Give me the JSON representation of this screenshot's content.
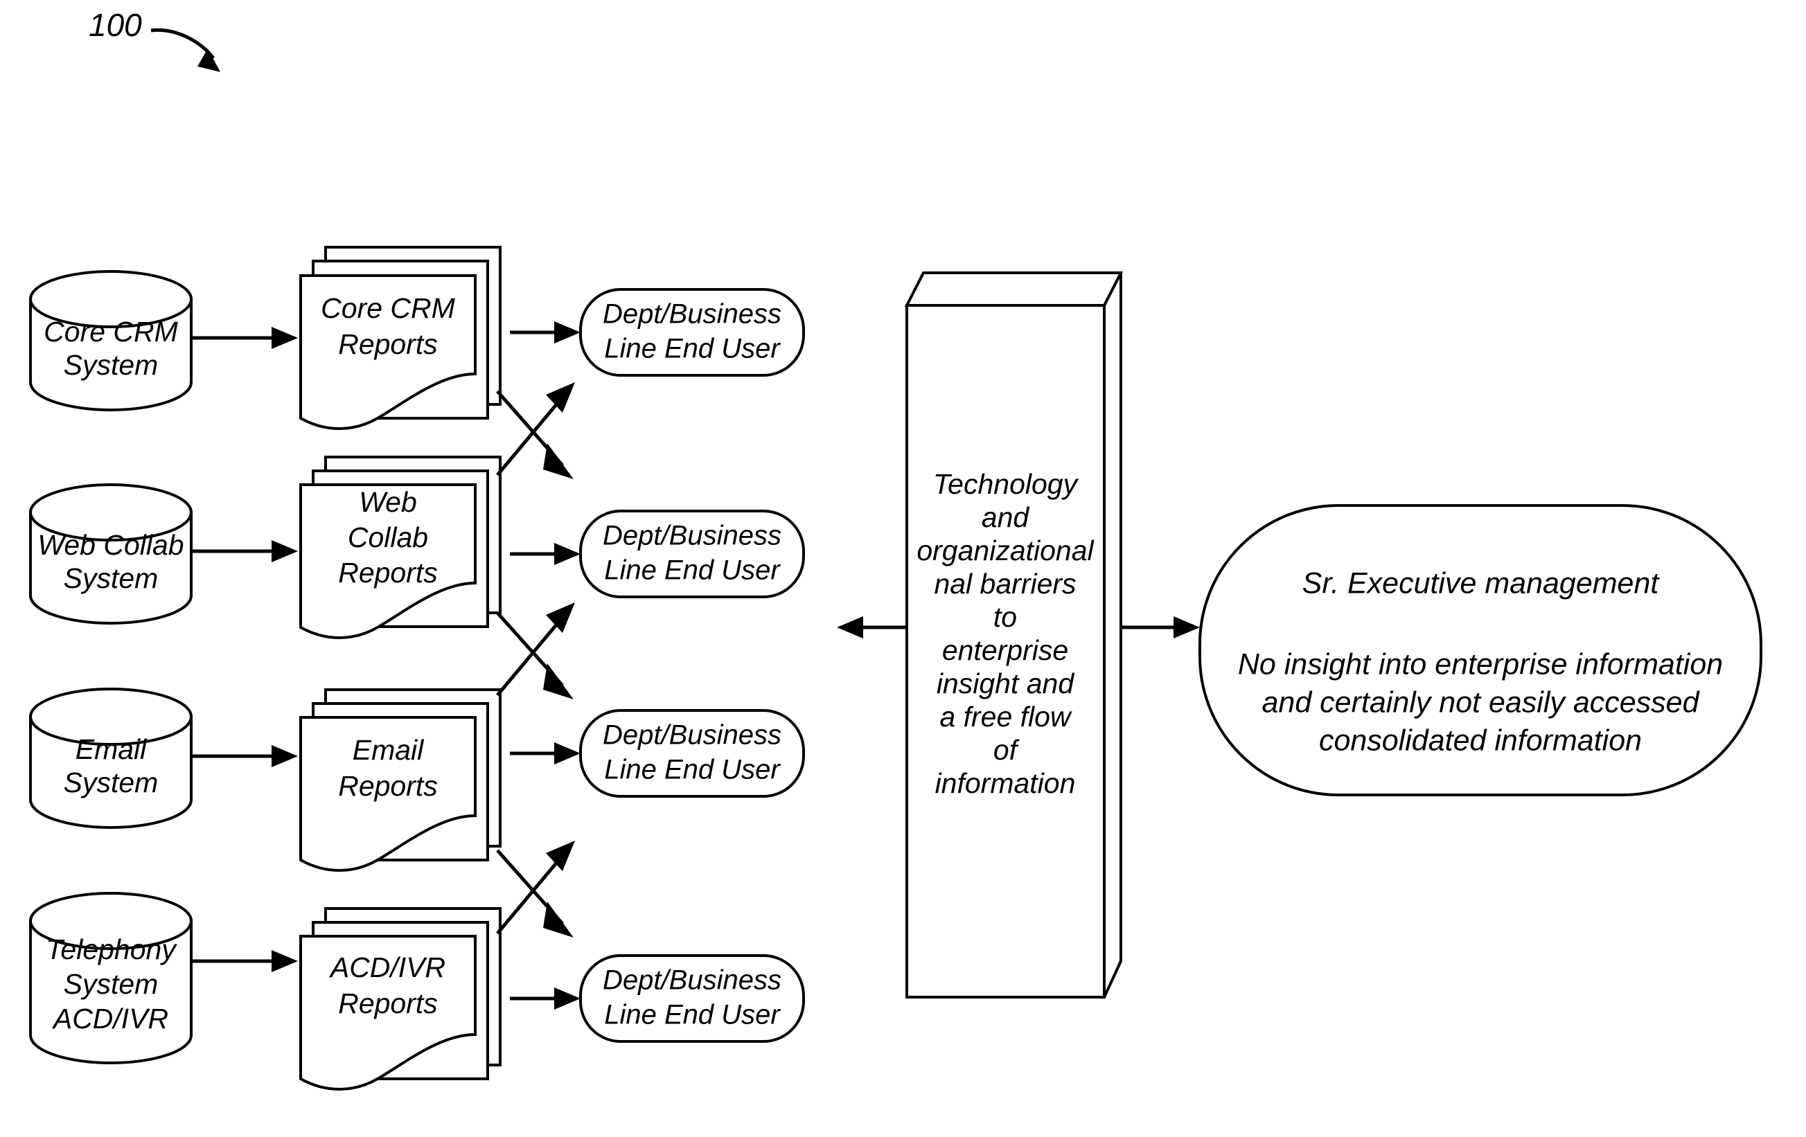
{
  "figure": {
    "reference_numeral": "100"
  },
  "sources": [
    {
      "id": "core-crm-system",
      "lines": [
        "Core CRM",
        "System"
      ]
    },
    {
      "id": "web-collab-system",
      "lines": [
        "Web Collab",
        "System"
      ]
    },
    {
      "id": "email-system",
      "lines": [
        "Email",
        "System"
      ]
    },
    {
      "id": "telephony-system",
      "lines": [
        "Telephony",
        "System",
        "ACD/IVR"
      ]
    }
  ],
  "reports": [
    {
      "id": "core-crm-reports",
      "lines": [
        "Core CRM",
        "Reports"
      ]
    },
    {
      "id": "web-collab-reports",
      "lines": [
        "Web",
        "Collab",
        "Reports"
      ]
    },
    {
      "id": "email-reports",
      "lines": [
        "Email",
        "Reports"
      ]
    },
    {
      "id": "acd-ivr-reports",
      "lines": [
        "ACD/IVR",
        "Reports"
      ]
    }
  ],
  "end_users": [
    {
      "id": "end-user-1",
      "lines": [
        "Dept/Business",
        "Line End User"
      ]
    },
    {
      "id": "end-user-2",
      "lines": [
        "Dept/Business",
        "Line End User"
      ]
    },
    {
      "id": "end-user-3",
      "lines": [
        "Dept/Business",
        "Line End User"
      ]
    },
    {
      "id": "end-user-4",
      "lines": [
        "Dept/Business",
        "Line End User"
      ]
    }
  ],
  "barrier_column": {
    "id": "barrier-column",
    "lines": [
      "Technology",
      "and",
      "organizational",
      "nal barriers",
      "to",
      "enterprise",
      "insight and",
      "a free flow",
      "of",
      "information"
    ]
  },
  "executive": {
    "id": "sr-executive-management",
    "title": "Sr. Executive management",
    "lines": [
      "No insight into enterprise information",
      "and certainly not easily accessed",
      "consolidated information"
    ]
  },
  "colors": {
    "ink": "#000000",
    "paper": "#ffffff"
  }
}
